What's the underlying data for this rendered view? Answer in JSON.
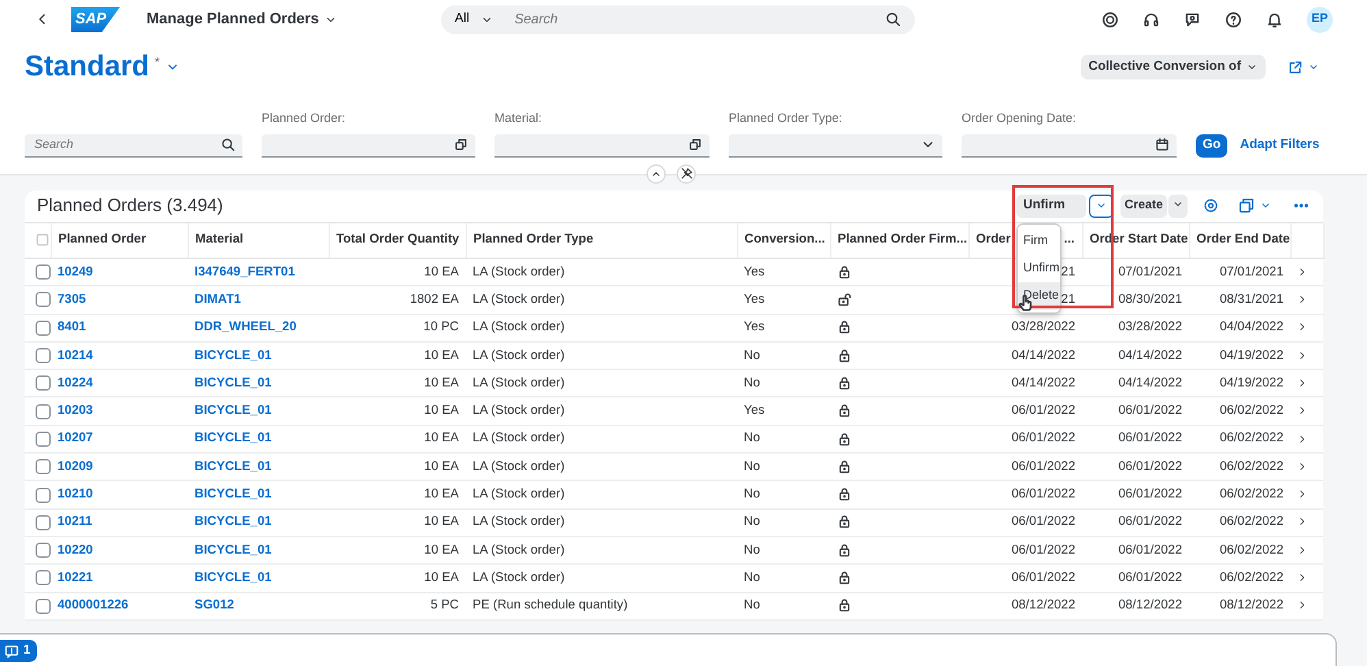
{
  "shell": {
    "logo": "SAP",
    "app_title": "Manage Planned Orders",
    "search_scope": "All",
    "search_placeholder": "Search",
    "avatar": "EP"
  },
  "variant": {
    "title": "Standard",
    "modified_mark": "*"
  },
  "header_actions": {
    "conversion_button": "Collective Conversion of"
  },
  "filter_bar": {
    "search_placeholder": "Search",
    "fields": [
      {
        "label": "Planned Order:",
        "kind": "valuehelp"
      },
      {
        "label": "Material:",
        "kind": "valuehelp"
      },
      {
        "label": "Planned Order Type:",
        "kind": "select"
      },
      {
        "label": "Order Opening Date:",
        "kind": "date"
      }
    ],
    "go_button": "Go",
    "adapt_filters": "Adapt Filters"
  },
  "table": {
    "title": "Planned Orders (3.494)",
    "toolbar": {
      "firm_button": "Unfirm",
      "create_button": "Create",
      "menu": [
        {
          "label": "Firm",
          "selected": false
        },
        {
          "label": "Unfirm",
          "selected": false
        },
        {
          "label": "Delete",
          "selected": true
        }
      ]
    },
    "columns": [
      {
        "label": "Planned Order"
      },
      {
        "label": "Material"
      },
      {
        "label": "Total Order Quantity"
      },
      {
        "label": "Planned Order Type"
      },
      {
        "label": "Conversion..."
      },
      {
        "label": "Planned Order Firm..."
      },
      {
        "label": "Order",
        "label_tail": "..."
      },
      {
        "label": "Order Start Date"
      },
      {
        "label": "Order End Date"
      }
    ],
    "rows": [
      {
        "checked": false,
        "order": "10249",
        "material": "I347649_FERT01",
        "quantity": "10 EA",
        "type": "LA (Stock order)",
        "conversion": "Yes",
        "firmed": true,
        "opening": "21",
        "start": "07/01/2021",
        "end": "07/01/2021"
      },
      {
        "checked": false,
        "order": "7305",
        "material": "DIMAT1",
        "quantity": "1802 EA",
        "type": "LA (Stock order)",
        "conversion": "Yes",
        "firmed": false,
        "opening": "21",
        "start": "08/30/2021",
        "end": "08/31/2021"
      },
      {
        "checked": false,
        "order": "8401",
        "material": "DDR_WHEEL_20",
        "quantity": "10 PC",
        "type": "LA (Stock order)",
        "conversion": "Yes",
        "firmed": true,
        "opening": "03/28/2022",
        "start": "03/28/2022",
        "end": "04/04/2022"
      },
      {
        "checked": false,
        "order": "10214",
        "material": "BICYCLE_01",
        "quantity": "10 EA",
        "type": "LA (Stock order)",
        "conversion": "No",
        "firmed": true,
        "opening": "04/14/2022",
        "start": "04/14/2022",
        "end": "04/19/2022"
      },
      {
        "checked": false,
        "order": "10224",
        "material": "BICYCLE_01",
        "quantity": "10 EA",
        "type": "LA (Stock order)",
        "conversion": "No",
        "firmed": true,
        "opening": "04/14/2022",
        "start": "04/14/2022",
        "end": "04/19/2022"
      },
      {
        "checked": false,
        "order": "10203",
        "material": "BICYCLE_01",
        "quantity": "10 EA",
        "type": "LA (Stock order)",
        "conversion": "Yes",
        "firmed": true,
        "opening": "06/01/2022",
        "start": "06/01/2022",
        "end": "06/02/2022"
      },
      {
        "checked": false,
        "order": "10207",
        "material": "BICYCLE_01",
        "quantity": "10 EA",
        "type": "LA (Stock order)",
        "conversion": "No",
        "firmed": true,
        "opening": "06/01/2022",
        "start": "06/01/2022",
        "end": "06/02/2022"
      },
      {
        "checked": false,
        "order": "10209",
        "material": "BICYCLE_01",
        "quantity": "10 EA",
        "type": "LA (Stock order)",
        "conversion": "No",
        "firmed": true,
        "opening": "06/01/2022",
        "start": "06/01/2022",
        "end": "06/02/2022"
      },
      {
        "checked": false,
        "order": "10210",
        "material": "BICYCLE_01",
        "quantity": "10 EA",
        "type": "LA (Stock order)",
        "conversion": "No",
        "firmed": true,
        "opening": "06/01/2022",
        "start": "06/01/2022",
        "end": "06/02/2022"
      },
      {
        "checked": false,
        "order": "10211",
        "material": "BICYCLE_01",
        "quantity": "10 EA",
        "type": "LA (Stock order)",
        "conversion": "No",
        "firmed": true,
        "opening": "06/01/2022",
        "start": "06/01/2022",
        "end": "06/02/2022"
      },
      {
        "checked": false,
        "order": "10220",
        "material": "BICYCLE_01",
        "quantity": "10 EA",
        "type": "LA (Stock order)",
        "conversion": "No",
        "firmed": true,
        "opening": "06/01/2022",
        "start": "06/01/2022",
        "end": "06/02/2022"
      },
      {
        "checked": false,
        "order": "10221",
        "material": "BICYCLE_01",
        "quantity": "10 EA",
        "type": "LA (Stock order)",
        "conversion": "No",
        "firmed": true,
        "opening": "06/01/2022",
        "start": "06/01/2022",
        "end": "06/02/2022"
      },
      {
        "checked": false,
        "order": "4000001226",
        "material": "SG012",
        "quantity": "5 PC",
        "type": "PE (Run schedule quantity)",
        "conversion": "No",
        "firmed": true,
        "opening": "08/12/2022",
        "start": "08/12/2022",
        "end": "08/12/2022"
      }
    ]
  },
  "footer": {
    "message_count": "1"
  }
}
